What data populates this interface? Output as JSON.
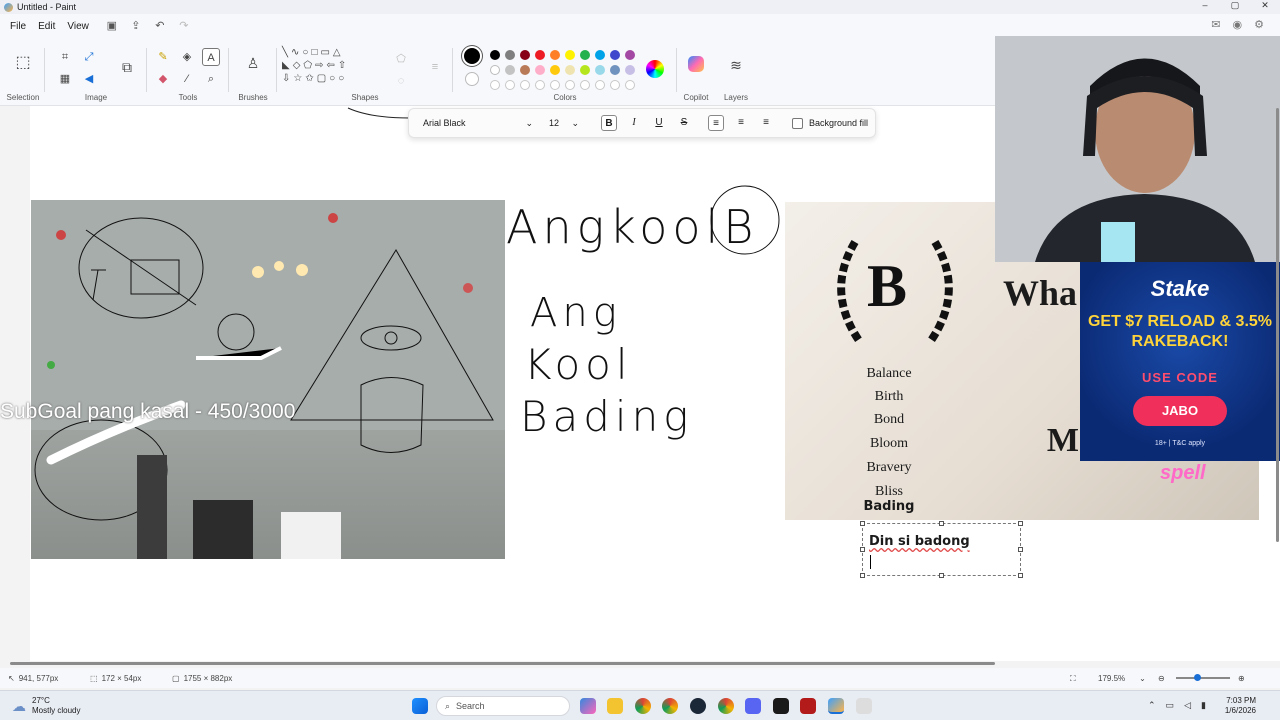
{
  "window": {
    "title": "Untitled - Paint",
    "minimize": "–",
    "maximize": "▢",
    "close": "✕"
  },
  "menu": {
    "file": "File",
    "edit": "Edit",
    "view": "View"
  },
  "ribbon": {
    "selection": "Selection",
    "image": "Image",
    "tools": "Tools",
    "brushes": "Brushes",
    "shapes": "Shapes",
    "colors": "Colors",
    "copilot": "Copilot",
    "layers": "Layers",
    "palette_row1": [
      "#000000",
      "#7f7f7f",
      "#880015",
      "#ed1c24",
      "#ff7f27",
      "#fff200",
      "#22b14c",
      "#00a2e8",
      "#3f48cc",
      "#a349a4"
    ],
    "palette_row2": [
      "#ffffff",
      "#c3c3c3",
      "#b97a57",
      "#ffaec9",
      "#ffc90e",
      "#efe4b0",
      "#b5e61d",
      "#99d9ea",
      "#7092be",
      "#c8bfe7"
    ]
  },
  "text_toolbar": {
    "font": "Arial Black",
    "size": "12",
    "bold": "B",
    "italic": "I",
    "underline": "U",
    "strike": "S",
    "background_fill": "Background fill"
  },
  "canvas": {
    "overlay_text": "SubGoal pang kasal - 450/3000",
    "handwriting_1": "AngkoolB",
    "handwriting_2": "Ang",
    "handwriting_3": "Kool",
    "handwriting_4": "Bading",
    "poster_letter": "B",
    "poster_words": [
      "Balance",
      "Birth",
      "Bond",
      "Bloom",
      "Bravery",
      "Bliss"
    ],
    "poster_extra": "Bading",
    "poster_partial_1": "Wha",
    "poster_partial_2": "M",
    "poster_brand": "spell",
    "textbox_text": "Din si badong"
  },
  "ad": {
    "brand": "Stake",
    "promo": "GET $7 RELOAD & 3.5% RAKEBACK!",
    "use_code": "USE CODE",
    "code": "JABO",
    "terms": "18+ | T&C apply"
  },
  "status": {
    "cursor": "941, 577px",
    "selection_size": "172 × 54px",
    "canvas_size": "1755 × 882px",
    "zoom": "179.5%"
  },
  "taskbar": {
    "temp": "27°C",
    "weather": "Mostly cloudy",
    "search": "Search",
    "time": "7:03 PM",
    "date": "1/6/2026"
  }
}
